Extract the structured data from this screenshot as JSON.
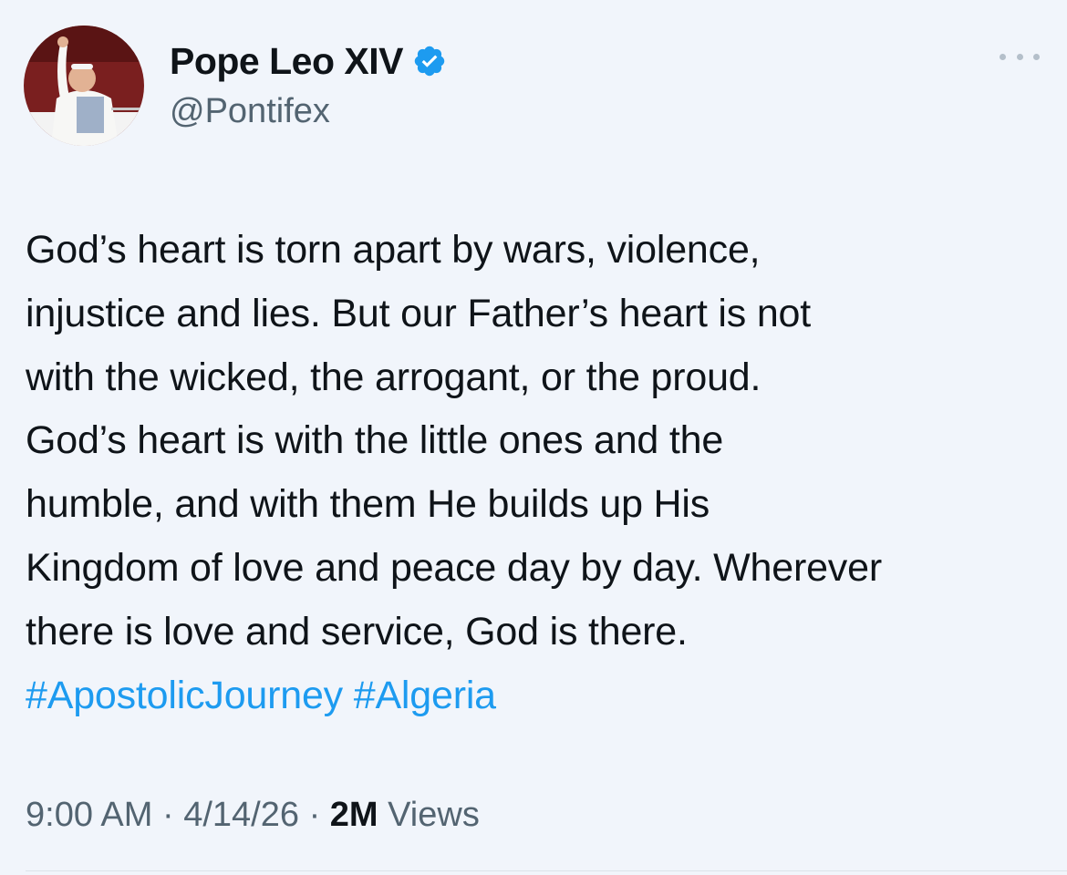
{
  "author": {
    "display_name": "Pope Leo XIV",
    "handle": "@Pontifex",
    "verified": true,
    "avatar_icon": "profile-photo"
  },
  "menu": {
    "icon": "more-options-icon"
  },
  "tweet": {
    "lines": [
      "God’s heart is torn apart by wars, violence,",
      "injustice and lies. But our Father’s heart is not",
      "with the wicked, the arrogant, or the proud.",
      "God’s heart is with the little ones and the",
      "humble, and with them He builds up His",
      "Kingdom of love and peace day by day. Wherever",
      "there is love and service, God is there."
    ],
    "hashtags": [
      "#ApostolicJourney",
      "#Algeria"
    ]
  },
  "meta": {
    "time": "9:00 AM",
    "separator": "·",
    "date": "4/14/26",
    "views_count": "2M",
    "views_label": "Views"
  },
  "colors": {
    "background": "#f1f5fb",
    "text": "#0f1419",
    "secondary": "#536471",
    "link": "#1d9bf0",
    "verified_badge": "#1d9bf0"
  }
}
